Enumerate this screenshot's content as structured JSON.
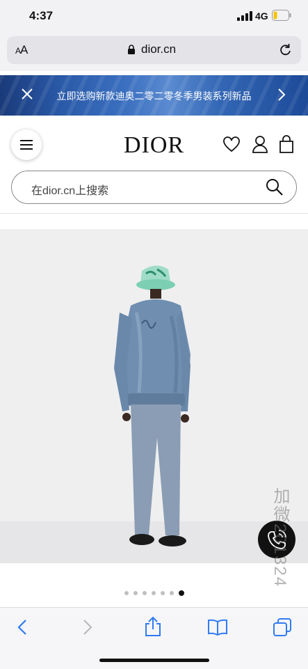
{
  "status_bar": {
    "time": "4:37",
    "network": "4G",
    "signal_icon": "signal-bars-icon",
    "battery_icon": "battery-icon",
    "battery_level": 0.25
  },
  "browser": {
    "text_size_label_small": "A",
    "text_size_label_large": "A",
    "domain": "dior.cn",
    "lock_icon": "lock-icon",
    "reload_icon": "reload-icon"
  },
  "banner": {
    "text": "立即选购新款迪奥二零二零冬季男装系列新品",
    "close_icon": "close-icon",
    "next_icon": "chevron-right-icon"
  },
  "header": {
    "logo": "DIOR",
    "menu_icon": "hamburger-menu-icon",
    "wishlist_icon": "heart-icon",
    "account_icon": "user-icon",
    "bag_icon": "shopping-bag-icon"
  },
  "search": {
    "placeholder": "在dior.cn上搜索",
    "icon": "search-icon"
  },
  "carousel": {
    "total": 7,
    "active_index": 6,
    "call_icon": "phone-call-icon"
  },
  "watermark": "加微201324",
  "toolbar": {
    "back_icon": "chevron-left-icon",
    "forward_icon": "chevron-right-icon",
    "share_icon": "share-icon",
    "bookmarks_icon": "book-icon",
    "tabs_icon": "tabs-icon"
  },
  "colors": {
    "accent_blue": "#2f7bf5",
    "banner_blue": "#2a5aa8"
  }
}
